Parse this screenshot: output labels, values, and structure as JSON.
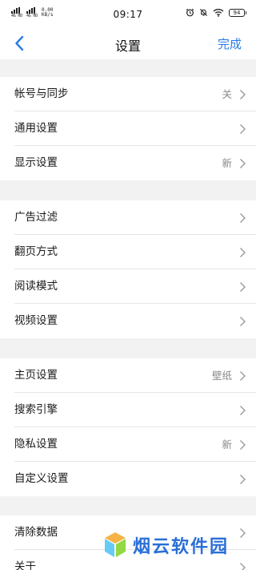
{
  "status_bar": {
    "sim1": "4G HD",
    "sim2": "4G HD",
    "speed_value": "0.00",
    "speed_unit": "KB/s",
    "time": "09:17",
    "battery": "94"
  },
  "nav": {
    "title": "设置",
    "done_label": "完成"
  },
  "groups": [
    {
      "items": [
        {
          "label": "帐号与同步",
          "value": "关"
        },
        {
          "label": "通用设置",
          "value": ""
        },
        {
          "label": "显示设置",
          "value": "新"
        }
      ]
    },
    {
      "items": [
        {
          "label": "广告过滤",
          "value": ""
        },
        {
          "label": "翻页方式",
          "value": ""
        },
        {
          "label": "阅读模式",
          "value": ""
        },
        {
          "label": "视频设置",
          "value": ""
        }
      ]
    },
    {
      "items": [
        {
          "label": "主页设置",
          "value": "壁纸"
        },
        {
          "label": "搜索引擎",
          "value": ""
        },
        {
          "label": "隐私设置",
          "value": "新"
        },
        {
          "label": "自定义设置",
          "value": ""
        }
      ]
    },
    {
      "items": [
        {
          "label": "清除数据",
          "value": ""
        },
        {
          "label": "关于",
          "value": ""
        }
      ]
    }
  ],
  "watermark": {
    "text": "烟云软件园"
  },
  "colors": {
    "accent": "#2a7ce6",
    "background": "#f2f2f2",
    "divider": "#e6e6e6"
  }
}
